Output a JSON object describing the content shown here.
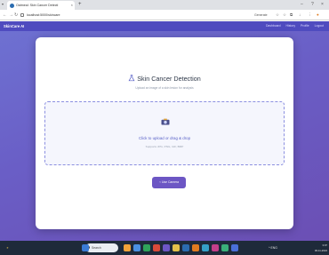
{
  "browser": {
    "tab_title": "Oatmeal: Skin Cancer Detecti",
    "tab_close": "×",
    "new_tab": "+",
    "tab_menu": "▾",
    "url": "localhost:5000/skincare",
    "profile_label": "Generate",
    "window_controls": [
      "–",
      "?",
      "×"
    ]
  },
  "app": {
    "brand": "SkinCare AI",
    "nav_links": [
      "Dashboard",
      "History",
      "Profile",
      "Logout"
    ],
    "title": "Skin Cancer Detection",
    "subtitle": "Upload an image of a skin lesion for analysis",
    "dropzone_text": "Click to upload or drag & drop",
    "dropzone_hint": "Supports JPG, PNG, GIF, BMP",
    "button_label": "Use Camera",
    "accent_color": "#6c56c4"
  },
  "taskbar": {
    "search_placeholder": "Search",
    "tray_text": "^ ENG",
    "clock_time": "3:07",
    "clock_date": "06-11-2024"
  }
}
